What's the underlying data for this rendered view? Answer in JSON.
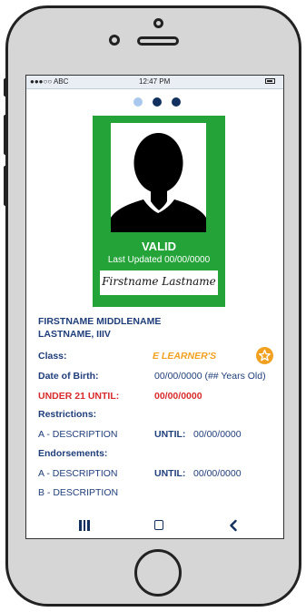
{
  "status_bar": {
    "carrier": "●●●○○ ABC",
    "time": "12:47 PM"
  },
  "pager": {
    "dots": 3,
    "active_index": 0
  },
  "card": {
    "status": "VALID",
    "last_updated": "Last Updated 00/00/0000",
    "signature": "Firstname Lastname",
    "accent_color": "#23a338"
  },
  "holder": {
    "name_line1": "FIRSTNAME MIDDLENAME",
    "name_line2": "LASTNAME, IIIV"
  },
  "details": {
    "class_label": "Class:",
    "class_value": "E LEARNER'S",
    "dob_label": "Date of Birth:",
    "dob_value": "00/00/0000 (## Years Old)",
    "under21_label": "UNDER 21 UNTIL:",
    "under21_value": "00/00/0000",
    "restrictions_label": "Restrictions:",
    "restrictions": [
      {
        "code": "A - DESCRIPTION",
        "until_label": "UNTIL:",
        "until_value": "00/00/0000"
      }
    ],
    "endorsements_label": "Endorsements:",
    "endorsements": [
      {
        "code": "A - DESCRIPTION",
        "until_label": "UNTIL:",
        "until_value": "00/00/0000"
      },
      {
        "code": "B - DESCRIPTION"
      }
    ]
  },
  "colors": {
    "text_blue": "#1f3e7a",
    "warning_red": "#d92b2b",
    "class_orange": "#f1a020"
  },
  "icons": {
    "favorite": "star-icon",
    "nav_recents": "recents-icon",
    "nav_home": "home-square-icon",
    "nav_back": "back-chevron-icon",
    "battery": "battery-icon"
  }
}
